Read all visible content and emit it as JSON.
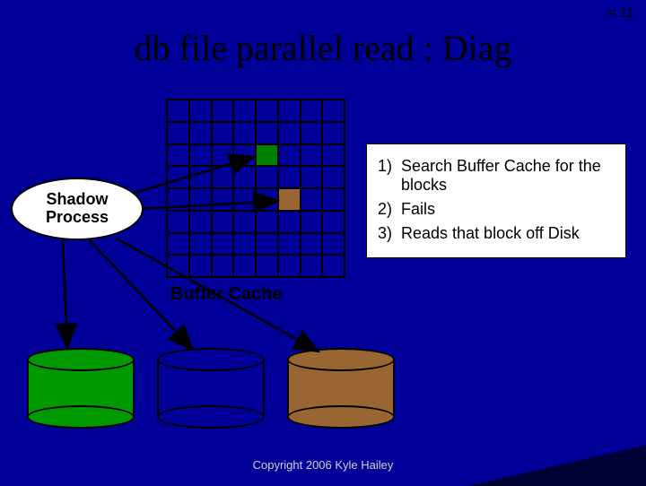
{
  "page_number": "#.11",
  "title": "db file parallel read : Diag",
  "shadow": {
    "line1": "Shadow",
    "line2": "Process"
  },
  "buffer_cache_label": "Buffer Cache",
  "steps": [
    {
      "n": "1)",
      "t": "Search Buffer Cache for the blocks"
    },
    {
      "n": "2)",
      "t": "Fails"
    },
    {
      "n": "3)",
      "t": "Reads that block off Disk"
    }
  ],
  "grid": {
    "rows": 8,
    "cols": 8,
    "filled": [
      {
        "r": 2,
        "c": 4,
        "color": "green"
      },
      {
        "r": 4,
        "c": 5,
        "color": "brown"
      }
    ]
  },
  "disks": [
    {
      "color": "green"
    },
    {
      "color": "blue"
    },
    {
      "color": "brown"
    }
  ],
  "footer": "Copyright 2006 Kyle Hailey"
}
